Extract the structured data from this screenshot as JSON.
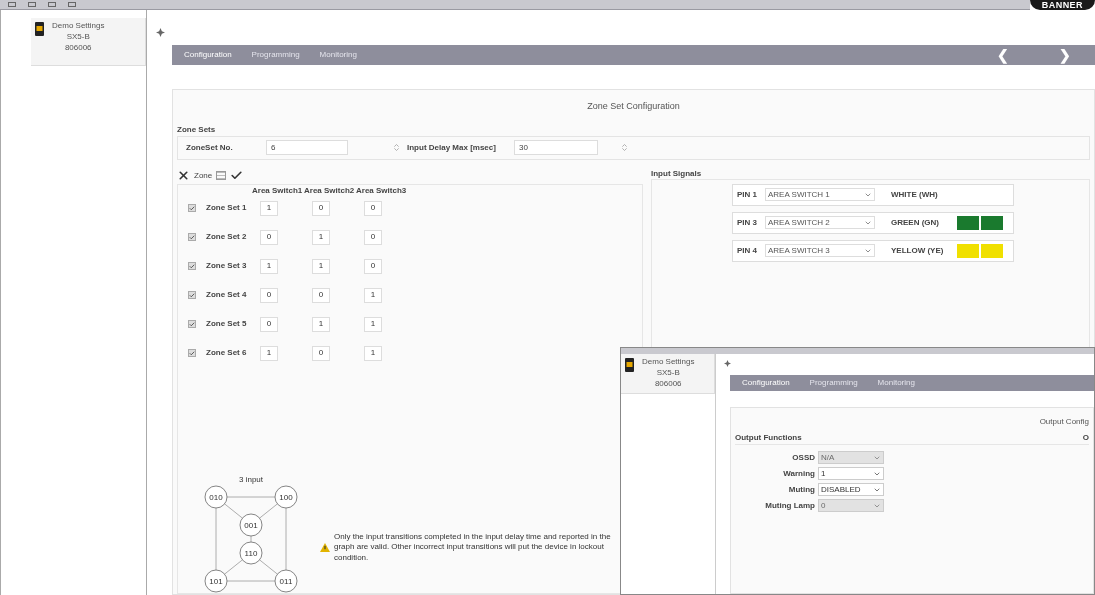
{
  "logo": "BANNER",
  "device": {
    "name": "Demo Settings",
    "model": "SX5-B",
    "serial": "806006"
  },
  "tabs": [
    {
      "label": "Configuration",
      "selected": true
    },
    {
      "label": "Programming",
      "selected": false
    },
    {
      "label": "Monitoring",
      "selected": false
    }
  ],
  "nav": [
    "❮",
    "❯"
  ],
  "panel_title": "Zone Set Configuration",
  "zone_sets": {
    "legend": "Zone Sets",
    "zoneset_label": "ZoneSet No.",
    "zoneset_value": "6",
    "delay_label": "Input Delay Max [msec]",
    "delay_value": "30"
  },
  "zone_group": {
    "label": "Zone",
    "columns": [
      "Area Switch1",
      "Area Switch2",
      "Area Switch3"
    ],
    "rows": [
      {
        "name": "Zone Set 1",
        "checked": true,
        "values": [
          "1",
          "0",
          "0"
        ]
      },
      {
        "name": "Zone Set 2",
        "checked": true,
        "values": [
          "0",
          "1",
          "0"
        ]
      },
      {
        "name": "Zone Set 3",
        "checked": true,
        "values": [
          "1",
          "1",
          "0"
        ]
      },
      {
        "name": "Zone Set 4",
        "checked": true,
        "values": [
          "0",
          "0",
          "1"
        ]
      },
      {
        "name": "Zone Set 5",
        "checked": true,
        "values": [
          "0",
          "1",
          "1"
        ]
      },
      {
        "name": "Zone Set 6",
        "checked": true,
        "values": [
          "1",
          "0",
          "1"
        ]
      }
    ]
  },
  "graph": {
    "title": "3 input",
    "nodes": [
      "010",
      "100",
      "001",
      "110",
      "101",
      "011"
    ]
  },
  "warning": "Only the input transitions completed in the input delay time and reported in the graph are valid. Other incorrect input transitions will put the device in lockout condition.",
  "input_signals": {
    "legend": "Input Signals",
    "pins": [
      {
        "pin": "PIN 1",
        "value": "AREA SWITCH 1",
        "wire": "WHITE (WH)"
      },
      {
        "pin": "PIN 3",
        "value": "AREA SWITCH 2",
        "wire": "GREEN (GN)",
        "color": "#1a7a2e"
      },
      {
        "pin": "PIN 4",
        "value": "AREA SWITCH 3",
        "wire": "YELLOW (YE)",
        "color": "#f0e000"
      }
    ]
  },
  "overlay": {
    "device": {
      "name": "Demo Settings",
      "model": "SX5-B",
      "serial": "806006"
    },
    "tabs": [
      {
        "label": "Configuration",
        "selected": true
      },
      {
        "label": "Programming",
        "selected": false
      },
      {
        "label": "Monitoring",
        "selected": false
      }
    ],
    "panel_title": "Output Config",
    "legend": "Output Functions",
    "right_legend": "O",
    "fields": [
      {
        "label": "OSSD",
        "value": "N/A",
        "disabled": true
      },
      {
        "label": "Warning",
        "value": "1",
        "disabled": false
      },
      {
        "label": "Muting",
        "value": "DISABLED",
        "disabled": false
      },
      {
        "label": "Muting Lamp",
        "value": "0",
        "disabled": true
      }
    ]
  }
}
